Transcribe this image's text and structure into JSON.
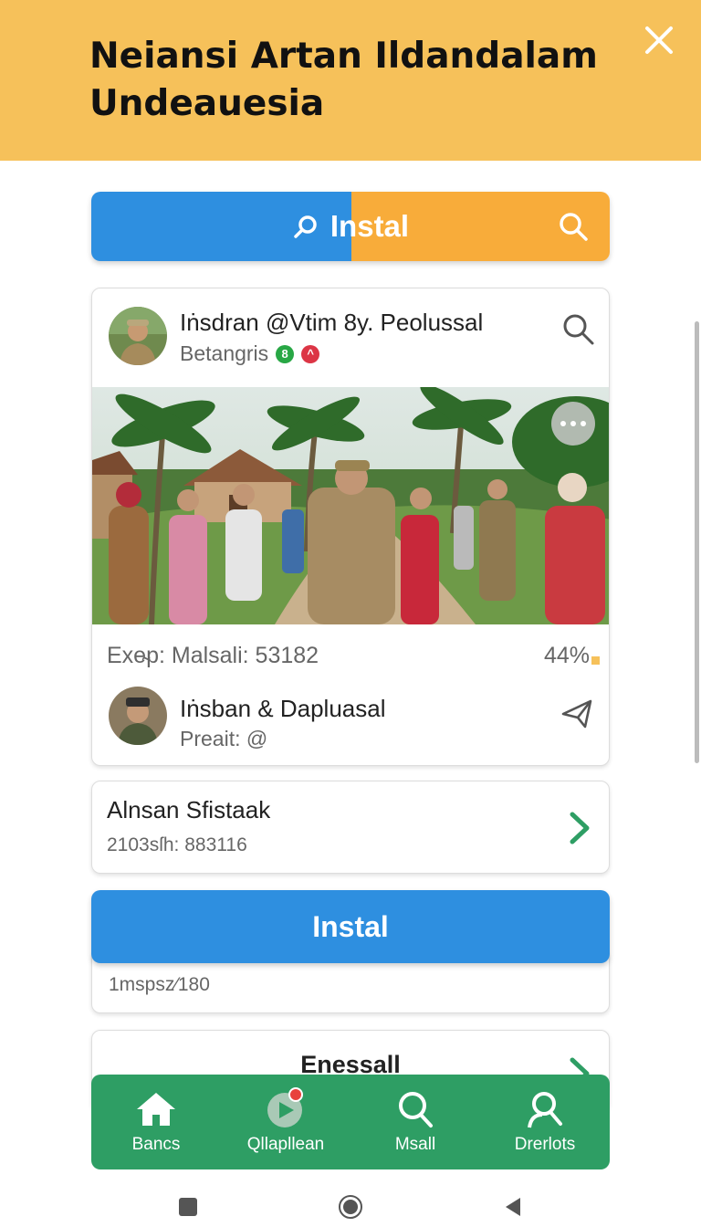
{
  "header": {
    "title": "Neiansi Artan Ildandalam Undeauesia",
    "bg_color": "#f6c15a"
  },
  "search_bar": {
    "label": "Instal",
    "left_color": "#2e8fe0",
    "right_color": "#f8ac3a"
  },
  "post": {
    "author": "Iṅsdran @Vtim 8y. Peolussal",
    "subtitle": "Betangris",
    "badge_1": "8",
    "badge_1_color": "#28a745",
    "badge_2": "^",
    "badge_2_color": "#dc3545",
    "image": "outdoor village photo of people walking under palm trees",
    "exp_label": "Exe̴p: Malsali: 53182",
    "percent": "44%",
    "second_author": "Iṅsban & Dapluasal",
    "second_sub": "Preait: @"
  },
  "row_card": {
    "title": "Alnsan Sfistaak",
    "subtitle": "2103sſh: 883116"
  },
  "install_button": {
    "label": "Instal",
    "color": "#2e8fe0"
  },
  "behind_card": {
    "text": "1mspsz⁄180"
  },
  "bottom_card": {
    "label": "Enessall"
  },
  "bottom_nav": {
    "color": "#2e9e64",
    "items": [
      {
        "label": "Bancs",
        "icon": "home-icon"
      },
      {
        "label": "Qllapllean",
        "icon": "play-icon"
      },
      {
        "label": "Msall",
        "icon": "search-icon"
      },
      {
        "label": "Drerlots",
        "icon": "user-search-icon"
      }
    ]
  },
  "system_nav": {
    "icons": [
      "square-icon",
      "circle-icon",
      "back-triangle-icon"
    ]
  }
}
